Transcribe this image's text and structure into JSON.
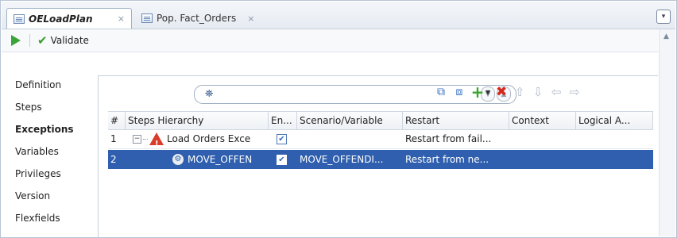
{
  "tabs": [
    {
      "label": "OELoadPlan",
      "close": "×",
      "active": true
    },
    {
      "label": "Pop. Fact_Orders",
      "close": "×",
      "active": false
    }
  ],
  "window": {
    "dropdown_icon": "▾"
  },
  "toolbar": {
    "run_icon": "play-icon",
    "validate_label": "Validate"
  },
  "nav": {
    "items": [
      "Definition",
      "Steps",
      "Exceptions",
      "Variables",
      "Privileges",
      "Version",
      "Flexfields"
    ],
    "selected": "Exceptions"
  },
  "search": {
    "value": "",
    "icon": "binoculars-icon"
  },
  "table": {
    "columns": [
      "#",
      "Steps Hierarchy",
      "En...",
      "Scenario/Variable",
      "Restart",
      "Context",
      "Logical A..."
    ],
    "rows": [
      {
        "num": "1",
        "step": "Load Orders Exce",
        "enabled": true,
        "scenario": "",
        "restart": "Restart from fail...",
        "context": "",
        "logical": "",
        "icon": "warning-icon",
        "selected": false
      },
      {
        "num": "2",
        "step": "MOVE_OFFEN",
        "enabled": true,
        "scenario": "MOVE_OFFENDI...",
        "restart": "Restart from ne...",
        "context": "",
        "logical": "",
        "icon": "gear-icon",
        "selected": true
      }
    ]
  },
  "colors": {
    "selection": "#2f5fae",
    "accent_green": "#3ca52f",
    "delete_red": "#d52a1d"
  }
}
